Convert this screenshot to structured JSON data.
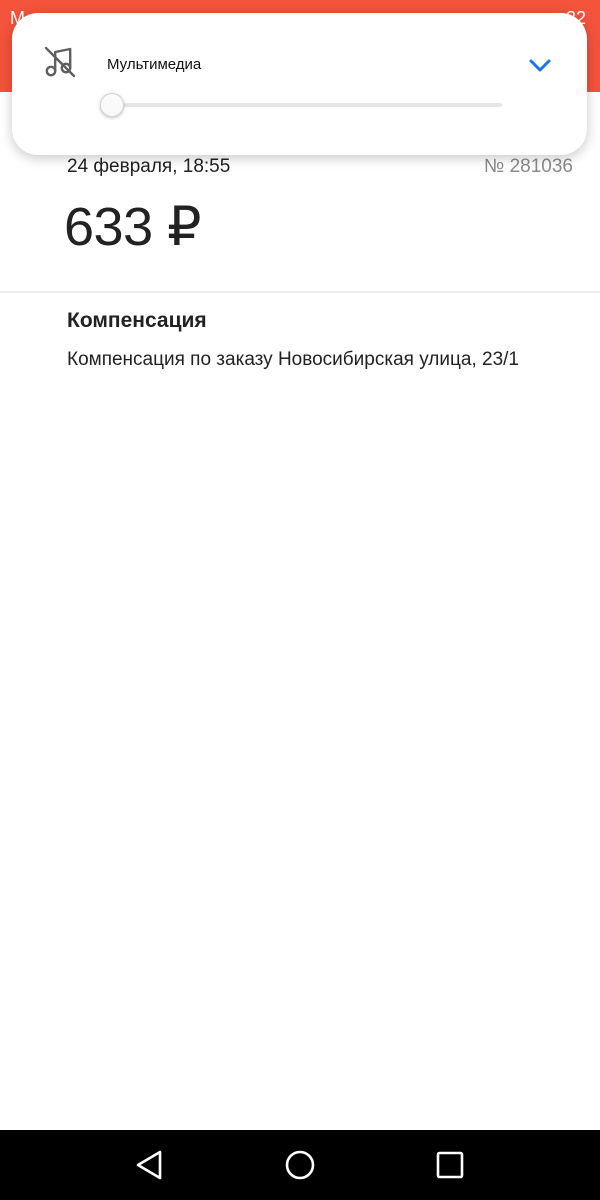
{
  "status_bar": {
    "left_text": "M",
    "right_text": "32",
    "color": "#f4533c"
  },
  "volume_panel": {
    "label": "Мультимедиа",
    "icon": "music-off-icon",
    "collapse_icon": "chevron-down-icon",
    "level_percent": 0,
    "accent_color": "#2f80ed"
  },
  "payment": {
    "date": "24 февраля, 18:55",
    "order_number": "№ 281036",
    "amount": "633 ₽"
  },
  "details": {
    "title": "Компенсация",
    "description": "Компенсация по заказу Новосибирская улица, 23/1"
  },
  "nav_bar": {
    "back_icon": "back-triangle-icon",
    "home_icon": "home-circle-icon",
    "recents_icon": "recents-square-icon"
  }
}
